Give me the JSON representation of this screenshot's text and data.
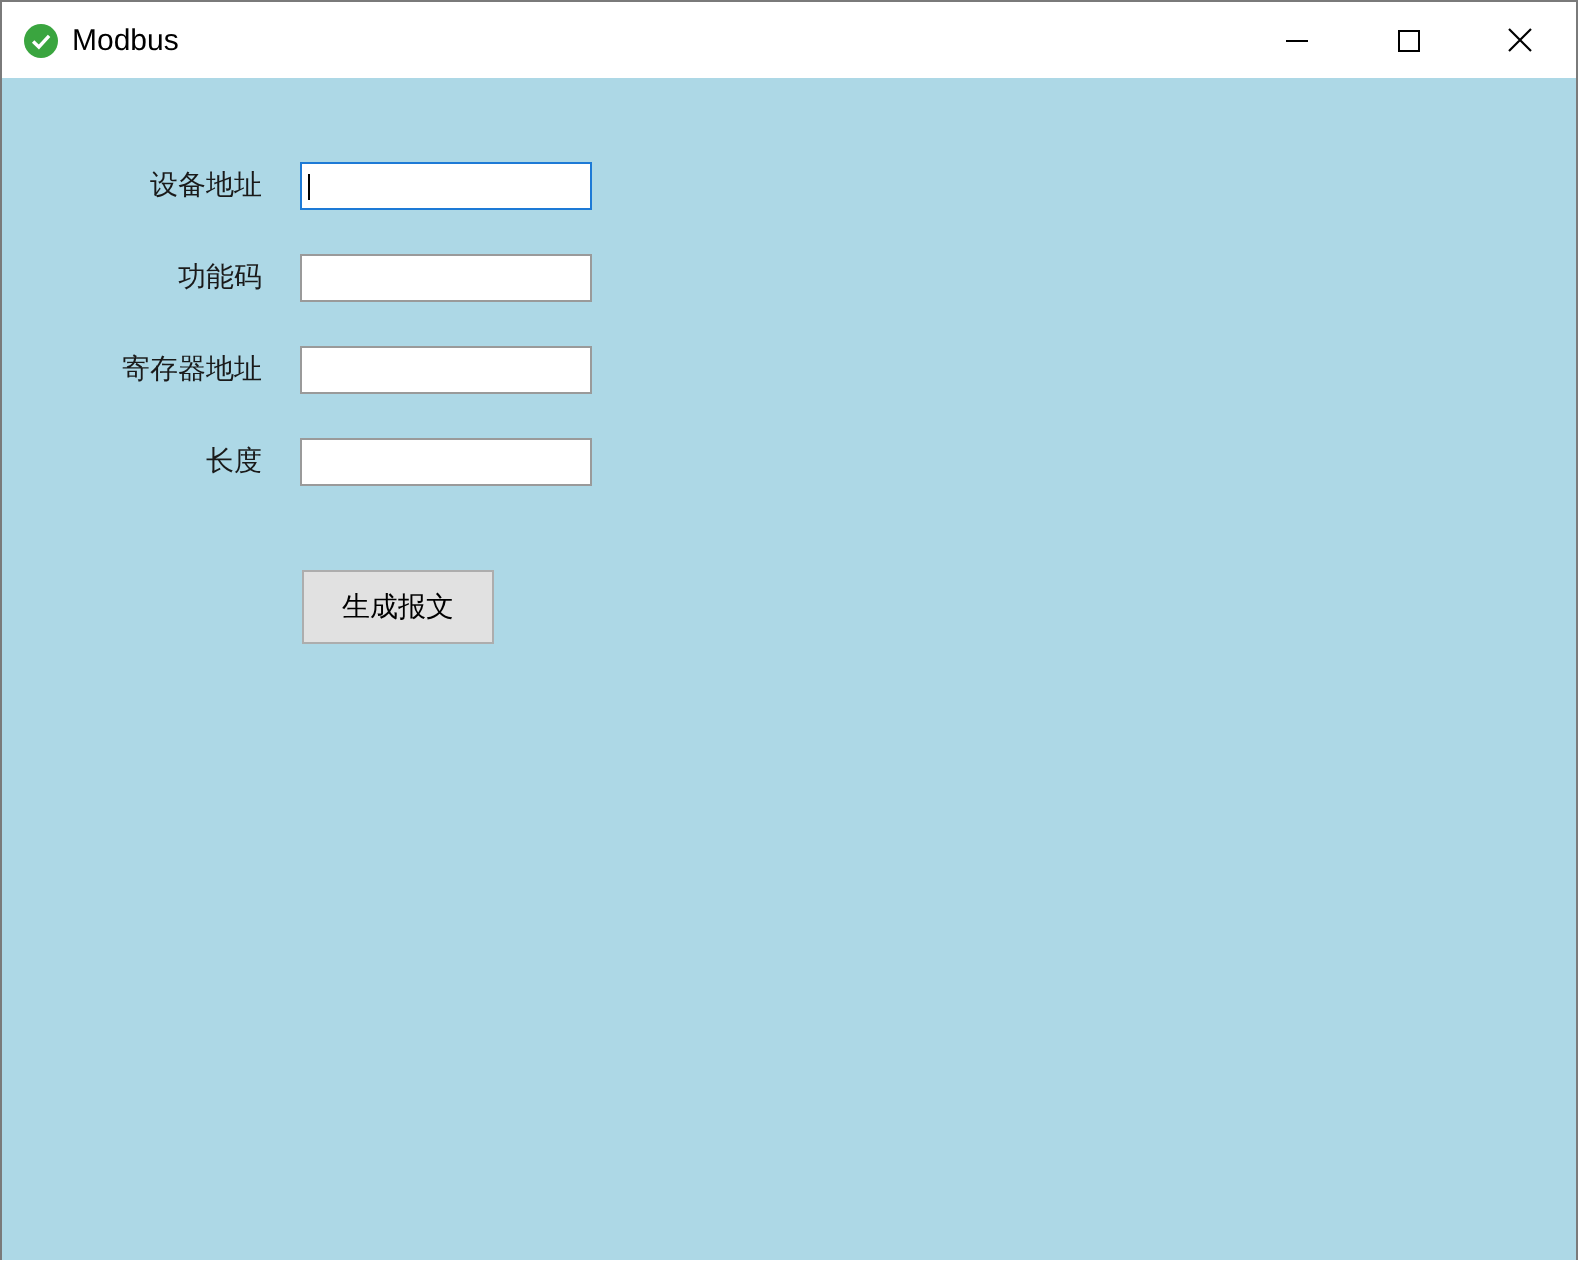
{
  "window": {
    "title": "Modbus"
  },
  "fields": [
    {
      "label": "设备地址",
      "focused": true
    },
    {
      "label": "功能码",
      "focused": false
    },
    {
      "label": "寄存器地址",
      "focused": false
    },
    {
      "label": "长度",
      "focused": false
    }
  ],
  "button": {
    "label": "生成报文"
  }
}
